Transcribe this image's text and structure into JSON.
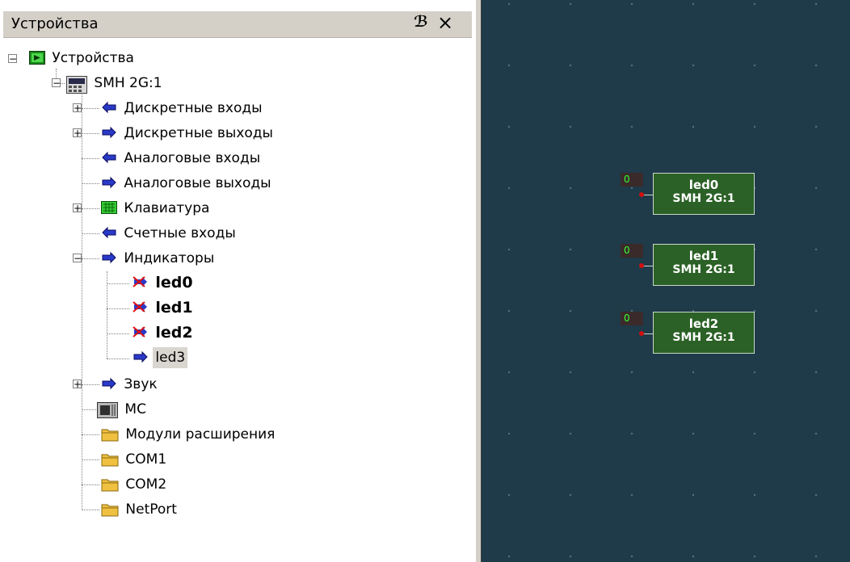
{
  "panel": {
    "title": "Устройства",
    "pin_glyph": "ℬ",
    "close_glyph": "×"
  },
  "tree": {
    "root": "Устройства",
    "device": "SMH 2G:1",
    "items": {
      "di": "Дискретные входы",
      "do": "Дискретные выходы",
      "ai": "Аналоговые входы",
      "ao": "Аналоговые выходы",
      "kbd": "Клавиатура",
      "cnt": "Счетные входы",
      "ind": "Индикаторы",
      "led0": "led0",
      "led1": "led1",
      "led2": "led2",
      "led3": "led3",
      "snd": "Звук",
      "mc": "MC",
      "ext": "Модули расширения",
      "com1": "COM1",
      "com2": "COM2",
      "net": "NetPort"
    }
  },
  "canvas": {
    "blocks": [
      {
        "name": "led0",
        "device": "SMH 2G:1",
        "input": "0"
      },
      {
        "name": "led1",
        "device": "SMH 2G:1",
        "input": "0"
      },
      {
        "name": "led2",
        "device": "SMH 2G:1",
        "input": "0"
      }
    ]
  },
  "colors": {
    "canvas_bg": "#1f3a49",
    "block_fill": "#2b6126",
    "pin": "#d01010",
    "input_value": "#35ff35",
    "selection": "#d9d5cf"
  }
}
